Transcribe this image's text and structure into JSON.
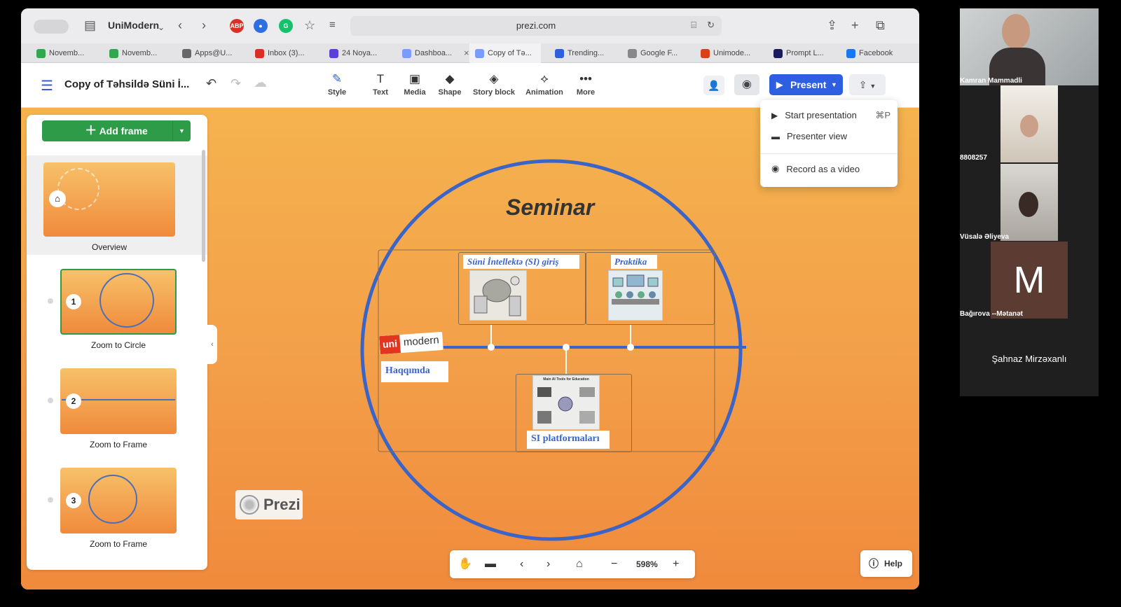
{
  "browser": {
    "profile": "UniModern",
    "url": "prezi.com",
    "extensions": [
      "ABP"
    ],
    "tabs": [
      {
        "label": "Novemb...",
        "color": "#2fa84f"
      },
      {
        "label": "Novemb...",
        "color": "#2fa84f"
      },
      {
        "label": "Apps@U...",
        "color": "#666666"
      },
      {
        "label": "Inbox (3)...",
        "color": "#d93025"
      },
      {
        "label": "24 Noya...",
        "color": "#5b3fd6"
      },
      {
        "label": "Dashboa...",
        "color": "#7b9cff"
      },
      {
        "label": "Copy of Tə...",
        "color": "#7b9cff"
      },
      {
        "label": "Trending...",
        "color": "#2d5fe0"
      },
      {
        "label": "Google F...",
        "color": "#888888"
      },
      {
        "label": "Unimode...",
        "color": "#d9401a"
      },
      {
        "label": "Prompt L...",
        "color": "#1a1a5e"
      },
      {
        "label": "Facebook",
        "color": "#1877f2"
      }
    ]
  },
  "prezi": {
    "title": "Copy of Təhsildə Süni İ...",
    "tools": [
      "Style",
      "Text",
      "Media",
      "Shape",
      "Story block",
      "Animation",
      "More"
    ],
    "present_label": "Present",
    "dropdown": {
      "start": "Start presentation",
      "shortcut": "⌘P",
      "presenter": "Presenter view",
      "record": "Record as a video"
    },
    "add_frame": "Add frame",
    "frames": [
      {
        "label": "Overview"
      },
      {
        "num": "1",
        "label": "Zoom to Circle"
      },
      {
        "num": "2",
        "label": "Zoom to Frame"
      },
      {
        "num": "3",
        "label": "Zoom to Frame"
      }
    ],
    "slide": {
      "title": "Seminar",
      "intro": "Süni İntellektə (SI) giriş",
      "practice": "Praktika",
      "platforms": "SI platformaları",
      "about": "Haqqımda",
      "logo_uni": "uni",
      "logo_modern": "modern",
      "mini_heading": "Main AI Tools for Education"
    },
    "watermark": "Prezi",
    "zoom": "598%",
    "help": "Help"
  },
  "participants": [
    {
      "name": "Kamran Mammadli"
    },
    {
      "name": "8808257"
    },
    {
      "name": "Vüsalə Əliyeva"
    },
    {
      "name": "Bağırova --Mətanət",
      "initial": "M"
    },
    {
      "name": "Şahnaz Mirzəxanlı"
    }
  ]
}
